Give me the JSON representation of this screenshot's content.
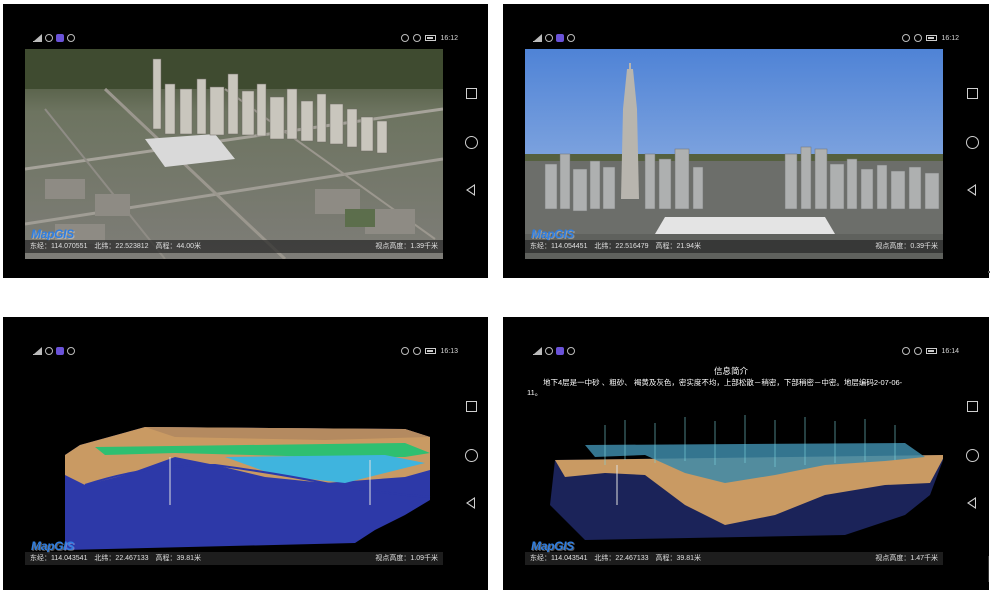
{
  "screens": [
    {
      "status": {
        "time": "16:12"
      },
      "logo": "MapGIS",
      "coords": {
        "lon": "东经：114.070551",
        "lat": "北纬：22.523812",
        "alt": "高程：44.00米"
      },
      "view_height": "视点高度：1.39千米"
    },
    {
      "status": {
        "time": "16:12"
      },
      "logo": "MapGIS",
      "coords": {
        "lon": "东经：114.054451",
        "lat": "北纬：22.516479",
        "alt": "高程：21.94米"
      },
      "view_height": "视点高度：0.39千米"
    },
    {
      "status": {
        "time": "16:13"
      },
      "logo": "MapGIS",
      "coords": {
        "lon": "东经：114.043541",
        "lat": "北纬：22.467133",
        "alt": "高程：39.81米"
      },
      "view_height": "视点高度：1.09千米"
    },
    {
      "status": {
        "time": "16:14"
      },
      "logo": "MapGIS",
      "info": {
        "title": "信息简介",
        "body": "地下4层是一中砂 、粗砂、 褐黄及灰色，密实度不均，上部松散－稍密，下部稍密－中密。地层编码2-07-06-11。"
      },
      "coords": {
        "lon": "东经：114.043541",
        "lat": "北纬：22.467133",
        "alt": "高程：39.81米"
      },
      "view_height": "视点高度：1.47千米"
    }
  ],
  "colors": {
    "brand": "#2f7fe3",
    "sky": "#5d8fd9",
    "sand": "#c99a63",
    "deep_blue": "#2d39a8",
    "water": "#3fb4de",
    "green_layer": "#2fbf71"
  },
  "icons": [
    "signal-icon",
    "wifi-icon",
    "app-badge-icon",
    "nfc-icon",
    "vibrate-icon",
    "alarm-icon",
    "battery-icon",
    "recent-apps-icon",
    "home-icon",
    "back-icon"
  ]
}
